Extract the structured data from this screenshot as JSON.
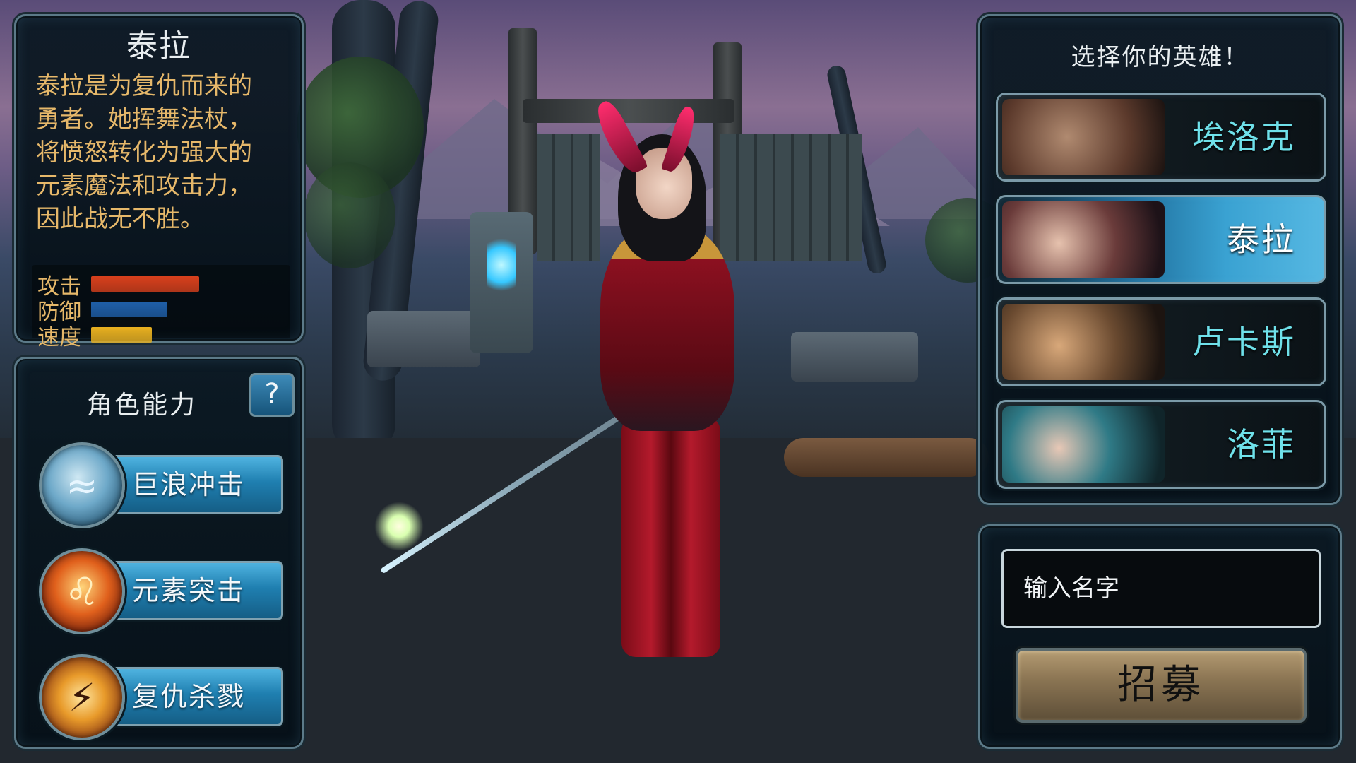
{
  "hero_info": {
    "name": "泰拉",
    "description": "泰拉是为复仇而来的\n勇者。她挥舞法杖，\n将愤怒转化为强大的\n元素魔法和攻击力，\n因此战无不胜。",
    "stats": [
      {
        "label": "攻击",
        "level": 0.85,
        "color": "#d8401c"
      },
      {
        "label": "防御",
        "level": 0.6,
        "color": "#1f5fa8"
      },
      {
        "label": "速度",
        "level": 0.48,
        "color": "#e8b020"
      }
    ]
  },
  "abilities": {
    "title": "角色能力",
    "help_label": "?",
    "items": [
      {
        "label": "巨浪冲击",
        "icon": "wave-icon"
      },
      {
        "label": "元素突击",
        "icon": "fire-lion-icon"
      },
      {
        "label": "复仇杀戮",
        "icon": "strike-icon"
      }
    ]
  },
  "hero_select": {
    "title": "选择你的英雄！",
    "heroes": [
      {
        "name": "埃洛克",
        "selected": false
      },
      {
        "name": "泰拉",
        "selected": true
      },
      {
        "name": "卢卡斯",
        "selected": false
      },
      {
        "name": "洛菲",
        "selected": false
      }
    ]
  },
  "recruit": {
    "name_placeholder": "输入名字",
    "button_label": "招募"
  },
  "colors": {
    "panel_border": "#5c7a88",
    "selected_card": "#3aa2d2",
    "hero_name": "#6fe1ea",
    "description_text": "#e6b86a",
    "recruit_button": "#8c7654"
  }
}
